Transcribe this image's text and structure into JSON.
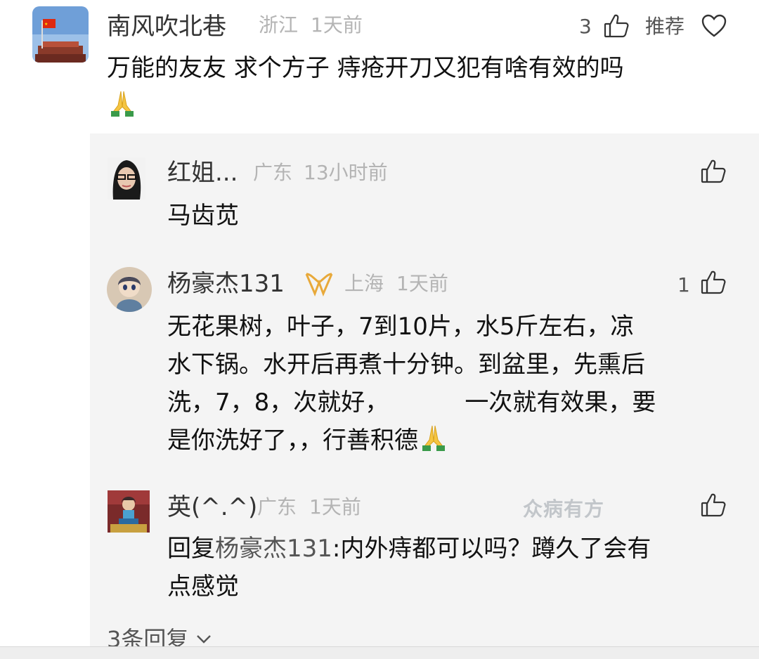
{
  "main_comment": {
    "username": "南风吹北巷",
    "location": "浙江",
    "time": "1天前",
    "like_count": "3",
    "recommend_label": "推荐",
    "content": "万能的友友  求个方子 痔疮开刀又犯有啥有效的吗"
  },
  "replies": [
    {
      "username": "红姐...",
      "location": "广东",
      "time": "13小时前",
      "content": "马齿苋"
    },
    {
      "username": "杨豪杰131",
      "location": "上海",
      "time": "1天前",
      "like_count": "1",
      "content_lines": [
        "无花果树，叶子，7到10片，水5斤左右，凉",
        "水下锅。水开后再煮十分钟。到盆里，先熏后",
        "洗，7，8，次就好，          一次就有效果，要",
        "是你洗好了，，行善积德"
      ]
    },
    {
      "username": "英(^.^)",
      "location": "广东",
      "time": "1天前",
      "reply_prefix": "回复",
      "reply_to": "杨豪杰131",
      "content_line1": ":内外痔都可以吗？蹲久了会有",
      "content_line2": "点感觉"
    }
  ],
  "watermark": "众病有方",
  "more_replies_label": "3条回复",
  "colors": {
    "username": "#333333",
    "meta": "#b4b4b4",
    "panel_bg": "#f4f4f4",
    "vip_badge": "#e8a93a"
  }
}
